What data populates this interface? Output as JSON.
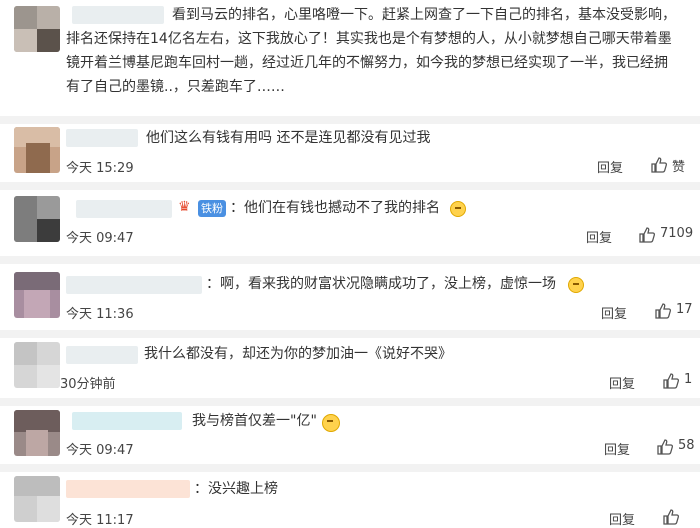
{
  "colors": {
    "separator": "#f2f2f2",
    "badge_blue": "#4a90e2",
    "text": "#333333"
  },
  "comments": [
    {
      "lines": [
        "看到马云的排名，心里咯噔一下。赶紧上网查了一下自己的排名，基本没受影响，",
        "排名还保持在14亿名左右，这下我放心了！其实我也是个有梦想的人，从小就梦想自己哪天带着墨",
        "镜开着兰博基尼跑车回村一趟，经过近几年的不懈努力，如今我的梦想已经实现了一半，我已经拥",
        "有了自己的墨镜..，只差跑车了……"
      ]
    },
    {
      "text": "他们这么有钱有用吗 还不是连见都没有见过我",
      "time": "今天 15:29",
      "reply": "回复",
      "likes": "赞"
    },
    {
      "badge": "铁粉",
      "text": "：他们在有钱也撼动不了我的排名",
      "time": "今天 09:47",
      "reply": "回复",
      "likes": "7109"
    },
    {
      "text": "：啊，看来我的财富状况隐瞒成功了，没上榜，虚惊一场",
      "time": "今天 11:36",
      "reply": "回复",
      "likes": "17"
    },
    {
      "text": "我什么都没有，却还为你的梦加油一《说好不哭》",
      "time": "30分钟前",
      "reply": "回复",
      "likes": "1"
    },
    {
      "text": "我与榜首仅差一\"亿\"",
      "time": "今天 09:47",
      "reply": "回复",
      "likes": "58"
    },
    {
      "text": "：没兴趣上榜",
      "time": "今天 11:17",
      "reply": "回复",
      "likes": ""
    }
  ]
}
